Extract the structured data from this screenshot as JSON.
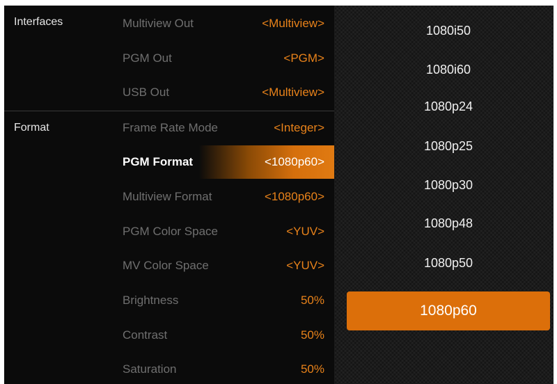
{
  "sections": {
    "interfaces": "Interfaces",
    "format": "Format"
  },
  "interfaces_rows": [
    {
      "label": "Multiview Out",
      "value": "<Multiview>"
    },
    {
      "label": "PGM Out",
      "value": "<PGM>"
    },
    {
      "label": "USB Out",
      "value": "<Multiview>"
    }
  ],
  "format_rows": [
    {
      "label": "Frame Rate Mode",
      "value": "<Integer>"
    },
    {
      "label": "PGM Format",
      "value": "<1080p60>"
    },
    {
      "label": "Multiview Format",
      "value": "<1080p60>"
    },
    {
      "label": "PGM Color Space",
      "value": "<YUV>"
    },
    {
      "label": "MV Color Space",
      "value": "<YUV>"
    },
    {
      "label": "Brightness",
      "value": "50%"
    },
    {
      "label": "Contrast",
      "value": "50%"
    },
    {
      "label": "Saturation",
      "value": "50%"
    }
  ],
  "dropdown": {
    "options": [
      "1080i50",
      "1080i60",
      "1080p24",
      "1080p25",
      "1080p30",
      "1080p48",
      "1080p50",
      "1080p60"
    ],
    "selected": "1080p60"
  },
  "colors": {
    "accent": "#e8821a",
    "selected_option_bg": "#dc6f0a",
    "inactive_text": "#6f6f6f"
  }
}
